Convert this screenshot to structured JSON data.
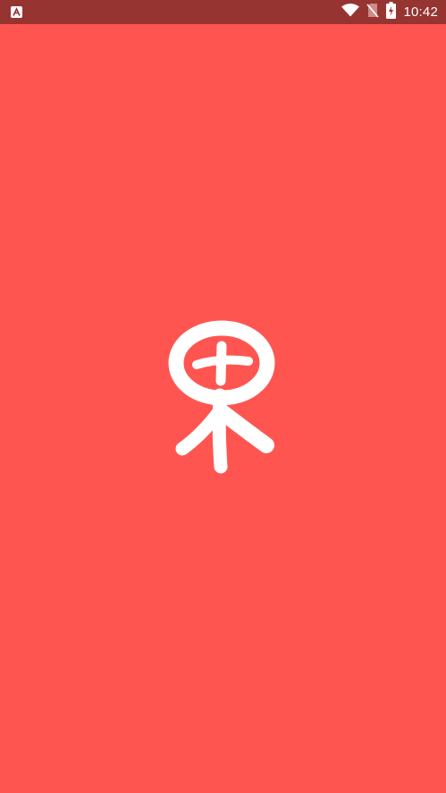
{
  "status_bar": {
    "time": "10:42",
    "background_color": "#963432",
    "icons": [
      "app-notification-icon",
      "wifi-icon",
      "no-sim-icon",
      "battery-charging-icon"
    ]
  },
  "splash": {
    "background_color": "#ff5551",
    "logo_icon": "fruit-logo-icon"
  }
}
